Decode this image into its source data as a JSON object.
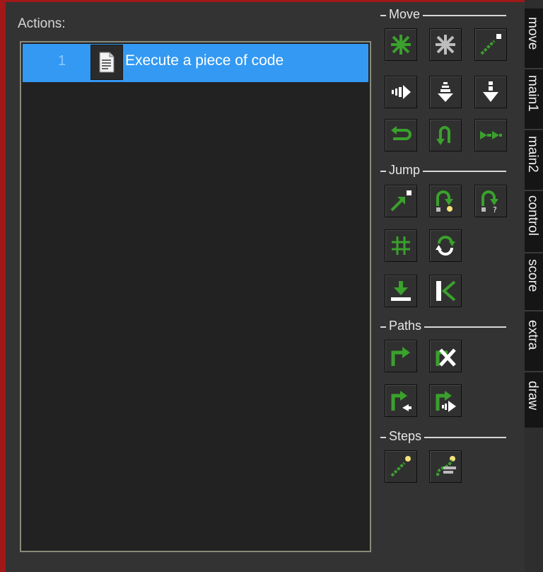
{
  "actions_panel": {
    "label": "Actions:",
    "items": [
      {
        "number": "1",
        "text": "Execute a piece of code",
        "icon": "document-icon"
      }
    ]
  },
  "palette": {
    "sections": [
      {
        "label": "Move"
      },
      {
        "label": "Jump"
      },
      {
        "label": "Paths"
      },
      {
        "label": "Steps"
      }
    ]
  },
  "tabs": [
    {
      "label": "move"
    },
    {
      "label": "main1"
    },
    {
      "label": "main2"
    },
    {
      "label": "control"
    },
    {
      "label": "score"
    },
    {
      "label": "extra"
    },
    {
      "label": "draw"
    }
  ],
  "colors": {
    "selection": "#3399f3",
    "icon_green": "#3aa12c",
    "window_border": "#a01818"
  }
}
